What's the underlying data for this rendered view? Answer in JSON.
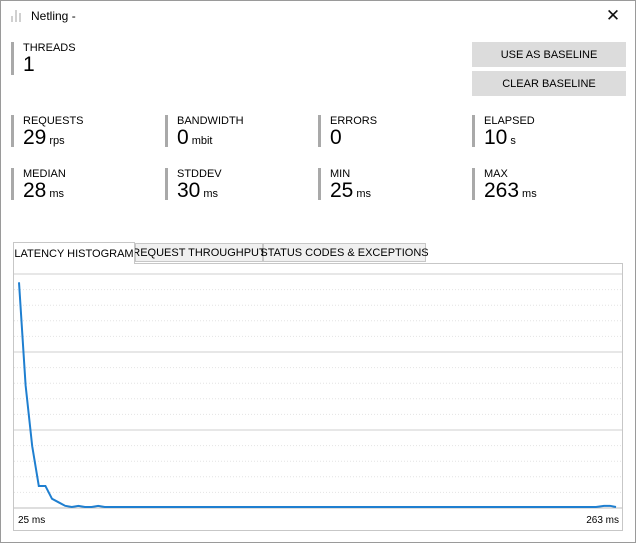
{
  "window": {
    "title": "Netling -"
  },
  "stats": {
    "threads": {
      "label": "THREADS",
      "value": "1",
      "unit": ""
    },
    "requests": {
      "label": "REQUESTS",
      "value": "29",
      "unit": "rps"
    },
    "bandwidth": {
      "label": "BANDWIDTH",
      "value": "0",
      "unit": "mbit"
    },
    "errors": {
      "label": "ERRORS",
      "value": "0",
      "unit": ""
    },
    "elapsed": {
      "label": "ELAPSED",
      "value": "10",
      "unit": "s"
    },
    "median": {
      "label": "MEDIAN",
      "value": "28",
      "unit": "ms"
    },
    "stddev": {
      "label": "STDDEV",
      "value": "30",
      "unit": "ms"
    },
    "min": {
      "label": "MIN",
      "value": "25",
      "unit": "ms"
    },
    "max": {
      "label": "MAX",
      "value": "263",
      "unit": "ms"
    }
  },
  "buttons": {
    "baseline": "USE AS BASELINE",
    "clear": "CLEAR BASELINE"
  },
  "tabs": [
    "LATENCY HISTOGRAM",
    "REQUEST THROUGHPUT",
    "STATUS CODES & EXCEPTIONS"
  ],
  "colors": {
    "line": "#1f7fd0",
    "stat_bar": "#a9a9a9",
    "button_bg": "#dcdcdc"
  },
  "chart_data": {
    "type": "line",
    "xlabel_left": "25 ms",
    "xlabel_right": "263 ms",
    "x_range": [
      25,
      263
    ],
    "ylim": [
      0,
      1
    ],
    "values": [
      0.96,
      0.52,
      0.26,
      0.09,
      0.09,
      0.035,
      0.02,
      0.005,
      0.0,
      0.005,
      0.0,
      0.0,
      0.005,
      0.0,
      0.0,
      0.005,
      0.005,
      0.0
    ]
  }
}
